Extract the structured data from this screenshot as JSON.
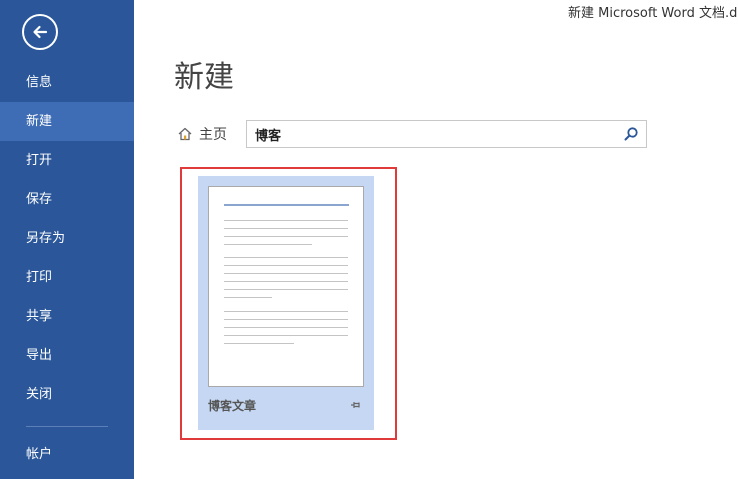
{
  "window": {
    "doc_title": "新建 Microsoft Word 文档.docx"
  },
  "sidebar": {
    "back_icon": "back-arrow-icon",
    "items": [
      {
        "label": "信息",
        "active": false
      },
      {
        "label": "新建",
        "active": true
      },
      {
        "label": "打开",
        "active": false
      },
      {
        "label": "保存",
        "active": false
      },
      {
        "label": "另存为",
        "active": false
      },
      {
        "label": "打印",
        "active": false
      },
      {
        "label": "共享",
        "active": false
      },
      {
        "label": "导出",
        "active": false
      },
      {
        "label": "关闭",
        "active": false
      }
    ],
    "account_label": "帐户"
  },
  "main": {
    "heading": "新建",
    "home_label": "主页",
    "search": {
      "value": "博客",
      "icon": "search-icon"
    },
    "templates": [
      {
        "name": "博客文章",
        "pin_icon": "pin-icon"
      }
    ]
  },
  "colors": {
    "sidebar_bg": "#2b579a",
    "sidebar_active": "#3e6db5",
    "card_bg": "#c5d7f2",
    "highlight": "#e03a3a"
  }
}
